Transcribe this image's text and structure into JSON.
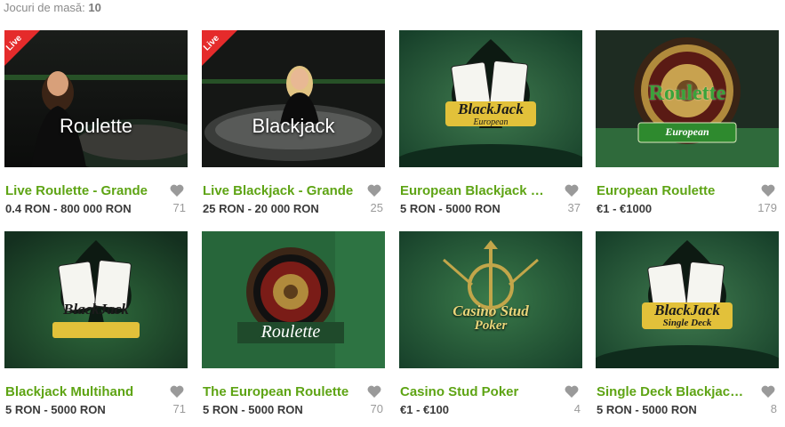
{
  "header": {
    "label": "Jocuri de masă:",
    "count": "10"
  },
  "colors": {
    "title": "#5ea414",
    "live_badge": "#e52b2b",
    "felt": "#1f5a33"
  },
  "games": [
    {
      "title": "Live Roulette - Grande",
      "price": "0.4 RON - 800 000 RON",
      "likes": "71",
      "badge": "Live",
      "thumb_text": "Roulette",
      "art": "live-roulette"
    },
    {
      "title": "Live Blackjack - Grande",
      "price": "25 RON - 20 000 RON",
      "likes": "25",
      "badge": "Live",
      "thumb_text": "Blackjack",
      "art": "live-blackjack"
    },
    {
      "title": "European Blackjack M...",
      "price": "5 RON - 5000 RON",
      "likes": "37",
      "logo_main": "BlackJack",
      "logo_sub": "European",
      "art": "blackjack"
    },
    {
      "title": "European Roulette",
      "price": "€1 - €1000",
      "likes": "179",
      "logo_main": "Roulette",
      "logo_sub": "European",
      "art": "roulette-wheel"
    },
    {
      "title": "Blackjack Multihand",
      "price": "5 RON - 5000 RON",
      "likes": "71",
      "logo_main": "BlackJack",
      "art": "blackjack-multi"
    },
    {
      "title": "The European Roulette",
      "price": "5 RON - 5000 RON",
      "likes": "70",
      "logo_main": "Roulette",
      "art": "roulette-top"
    },
    {
      "title": "Casino Stud Poker",
      "price": "€1 - €100",
      "likes": "4",
      "logo_main": "Casino Stud",
      "logo_sub": "Poker",
      "art": "stud-poker"
    },
    {
      "title": "Single Deck Blackjack ...",
      "price": "5 RON - 5000 RON",
      "likes": "8",
      "logo_main": "BlackJack",
      "logo_sub": "Single Deck",
      "art": "blackjack"
    }
  ]
}
